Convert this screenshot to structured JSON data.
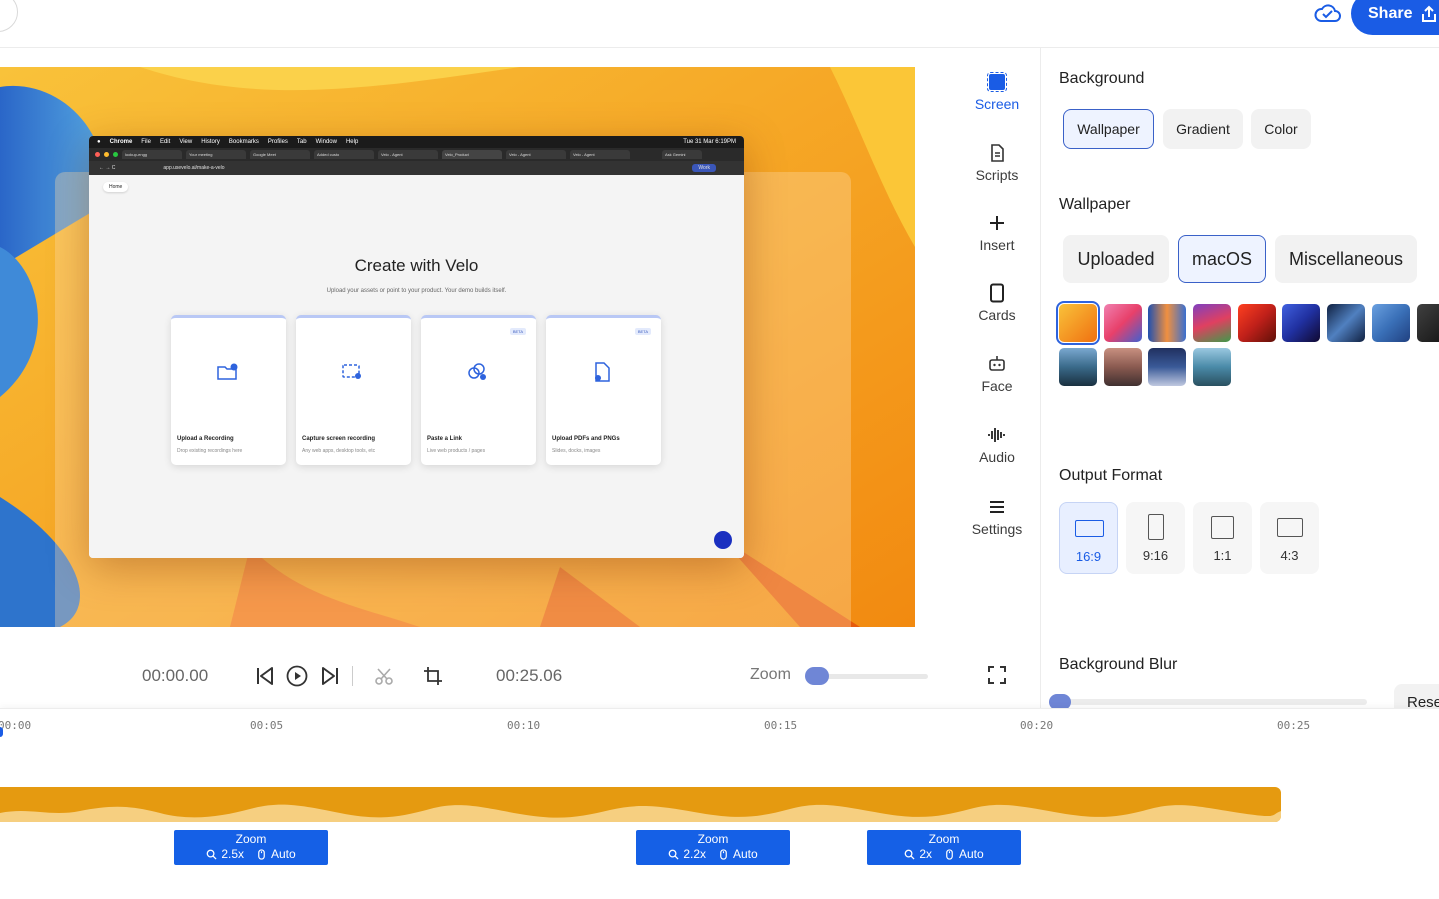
{
  "topbar": {
    "share_label": "Share"
  },
  "preview": {
    "menubar": {
      "items": [
        "Chrome",
        "File",
        "Edit",
        "View",
        "History",
        "Bookmarks",
        "Profiles",
        "Tab",
        "Window",
        "Help"
      ],
      "clock": "Tue 31 Mar 6:19PM"
    },
    "tabs": [
      "lookup-engg",
      "Your meeting",
      "Google Meet",
      "Added custo",
      "Velo - Agent",
      "Velo_Product",
      "Velo - Agent",
      "Velo - Agent"
    ],
    "url": "app.usevelo.ai/make-a-velo",
    "work_badge": "Work",
    "ask_gemini": "Ask Gemini",
    "home_chip": "Home",
    "title": "Create with Velo",
    "subtitle": "Upload your assets or point to your product. Your demo builds itself.",
    "cards": [
      {
        "title": "Upload a Recording",
        "desc": "Drop existing recordings here",
        "beta": ""
      },
      {
        "title": "Capture screen recording",
        "desc": "Any web apps, desktop tools, etc",
        "beta": ""
      },
      {
        "title": "Paste a Link",
        "desc": "Live web products / pages",
        "beta": "BETA"
      },
      {
        "title": "Upload PDFs and PNGs",
        "desc": "Slides, docks, images",
        "beta": "BETA"
      }
    ]
  },
  "rail": {
    "items": [
      {
        "label": "Screen",
        "icon": "screen-icon",
        "active": true
      },
      {
        "label": "Scripts",
        "icon": "document-icon"
      },
      {
        "label": "Insert",
        "icon": "plus-icon"
      },
      {
        "label": "Cards",
        "icon": "card-icon"
      },
      {
        "label": "Face",
        "icon": "face-icon"
      },
      {
        "label": "Audio",
        "icon": "waveform-icon"
      },
      {
        "label": "Settings",
        "icon": "menu-icon"
      }
    ]
  },
  "panel": {
    "background_heading": "Background",
    "background_options": [
      "Wallpaper",
      "Gradient",
      "Color"
    ],
    "background_selected": "Wallpaper",
    "wallpaper_heading": "Wallpaper",
    "wallpaper_tabs": [
      "Uploaded",
      "macOS",
      "Miscellaneous"
    ],
    "wallpaper_tab_selected": "macOS",
    "swatch_colors": [
      "#f59a12",
      "#e8406a",
      "#3a6fd0",
      "#3f9a4a",
      "#c0201a",
      "#2030a0",
      "#102040",
      "#3a70b8",
      "#202020",
      "#3a6a8a",
      "#8a5a50",
      "#3a5a98",
      "#4a8aa8"
    ],
    "output_heading": "Output Format",
    "formats": [
      "16:9",
      "9:16",
      "1:1",
      "4:3"
    ],
    "format_selected": "16:9",
    "blur_heading": "Background Blur",
    "reset_label": "Reset"
  },
  "controls": {
    "current_time": "00:00.00",
    "total_time": "00:25.06",
    "zoom_label": "Zoom",
    "zoom_level": 0
  },
  "timeline": {
    "ticks": [
      "00:00",
      "00:05",
      "00:10",
      "00:15",
      "00:20",
      "00:25"
    ],
    "zoom_segments": [
      {
        "label": "Zoom",
        "level": "2.5x",
        "mode": "Auto"
      },
      {
        "label": "Zoom",
        "level": "2.2x",
        "mode": "Auto"
      },
      {
        "label": "Zoom",
        "level": "2x",
        "mode": "Auto"
      }
    ]
  }
}
